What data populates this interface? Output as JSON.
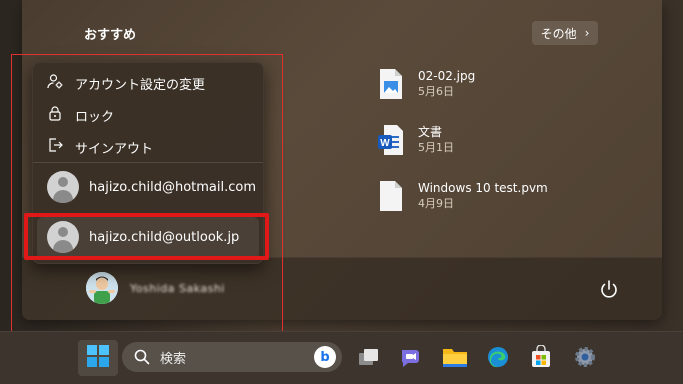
{
  "start_menu": {
    "recommended_title": "おすすめ",
    "more_label": "その他",
    "more_chevron": "›",
    "files": [
      {
        "name": "02-02.jpg",
        "date": "5月6日",
        "icon": "image-file-icon"
      },
      {
        "name": "文書",
        "date": "5月1日",
        "icon": "word-document-icon"
      },
      {
        "name": "Windows 10 test.pvm",
        "date": "4月9日",
        "icon": "generic-file-icon"
      }
    ],
    "user_name": "Yoshida Sakashi"
  },
  "account_menu": {
    "items": [
      {
        "label": "アカウント設定の変更",
        "icon": "account-settings-icon"
      },
      {
        "label": "ロック",
        "icon": "lock-icon"
      },
      {
        "label": "サインアウト",
        "icon": "sign-out-icon"
      }
    ],
    "accounts": [
      {
        "email": "hajizo.child@hotmail.com"
      },
      {
        "email": "hajizo.child@outlook.jp"
      }
    ]
  },
  "taskbar": {
    "search_placeholder": "検索",
    "bing_label": "b",
    "icons": [
      "task-view-icon",
      "teams-chat-icon",
      "file-explorer-icon",
      "edge-icon",
      "microsoft-store-icon",
      "settings-icon"
    ]
  },
  "colors": {
    "highlight_red": "#e01818",
    "menu_bg": "#3a3026"
  }
}
